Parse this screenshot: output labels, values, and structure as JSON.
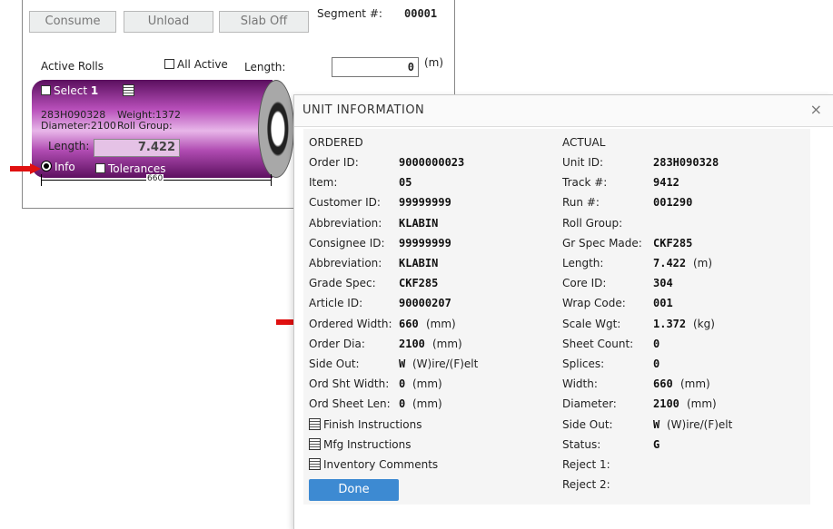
{
  "toolbar": {
    "consume": "Consume",
    "unload": "Unload",
    "slab_off": "Slab Off"
  },
  "segment": {
    "label": "Segment #:",
    "value": "00001"
  },
  "active_rolls": {
    "label": "Active Rolls",
    "all_active": "All Active",
    "length_label": "Length:",
    "length_value": "0",
    "length_unit": "(m)"
  },
  "roll": {
    "select_label": "Select",
    "select_num": "1",
    "unit_id": "283H090328",
    "weight": "Weight:1372",
    "diameter": "Diameter:2100",
    "roll_group": "Roll Group:",
    "length_label": "Length:",
    "length_value": "7.422",
    "info_label": "Info",
    "tolerances_label": "Tolerances",
    "width_dim": "660"
  },
  "modal": {
    "title": "UNIT INFORMATION",
    "close": "×",
    "ordered": {
      "heading": "ORDERED",
      "rows": [
        {
          "k": "Order ID:",
          "v": "9000000023",
          "u": ""
        },
        {
          "k": "Item:",
          "v": "05",
          "u": ""
        },
        {
          "k": "Customer ID:",
          "v": "99999999",
          "u": ""
        },
        {
          "k": "Abbreviation:",
          "v": "KLABIN",
          "u": ""
        },
        {
          "k": "Consignee ID:",
          "v": "99999999",
          "u": ""
        },
        {
          "k": "Abbreviation:",
          "v": "KLABIN",
          "u": ""
        },
        {
          "k": "Grade Spec:",
          "v": "CKF285",
          "u": ""
        },
        {
          "k": "Article ID:",
          "v": "90000207",
          "u": ""
        },
        {
          "k": "Ordered Width:",
          "v": "660",
          "u": "(mm)"
        },
        {
          "k": "Order Dia:",
          "v": "2100",
          "u": "(mm)"
        },
        {
          "k": "Side Out:",
          "v": "W",
          "u": "(W)ire/(F)elt"
        },
        {
          "k": "Ord Sht Width:",
          "v": "0",
          "u": "(mm)"
        },
        {
          "k": "Ord Sheet Len:",
          "v": "0",
          "u": "(mm)"
        }
      ],
      "links": [
        "Finish Instructions",
        "Mfg Instructions",
        "Inventory Comments"
      ]
    },
    "actual": {
      "heading": "ACTUAL",
      "rows": [
        {
          "k": "Unit ID:",
          "v": "283H090328",
          "u": ""
        },
        {
          "k": "Track #:",
          "v": "9412",
          "u": ""
        },
        {
          "k": "Run #:",
          "v": "001290",
          "u": ""
        },
        {
          "k": "Roll Group:",
          "v": "",
          "u": ""
        },
        {
          "k": "Gr Spec Made:",
          "v": "CKF285",
          "u": ""
        },
        {
          "k": "Length:",
          "v": "7.422",
          "u": "(m)"
        },
        {
          "k": "Core ID:",
          "v": "304",
          "u": ""
        },
        {
          "k": "Wrap Code:",
          "v": "001",
          "u": ""
        },
        {
          "k": "Scale Wgt:",
          "v": "1.372",
          "u": "(kg)"
        },
        {
          "k": "Sheet Count:",
          "v": "0",
          "u": ""
        },
        {
          "k": "Splices:",
          "v": "0",
          "u": ""
        },
        {
          "k": "Width:",
          "v": "660",
          "u": "(mm)"
        },
        {
          "k": "Diameter:",
          "v": "2100",
          "u": "(mm)"
        },
        {
          "k": "Side Out:",
          "v": "W",
          "u": "(W)ire/(F)elt"
        },
        {
          "k": "Status:",
          "v": "G",
          "u": ""
        },
        {
          "k": "Reject 1:",
          "v": "",
          "u": ""
        },
        {
          "k": "Reject 2:",
          "v": "",
          "u": ""
        }
      ]
    },
    "done": "Done"
  },
  "colors": {
    "accent_blue": "#3d8ad2",
    "roll_purple": "#b84fba",
    "arrow_red": "#e01010"
  }
}
